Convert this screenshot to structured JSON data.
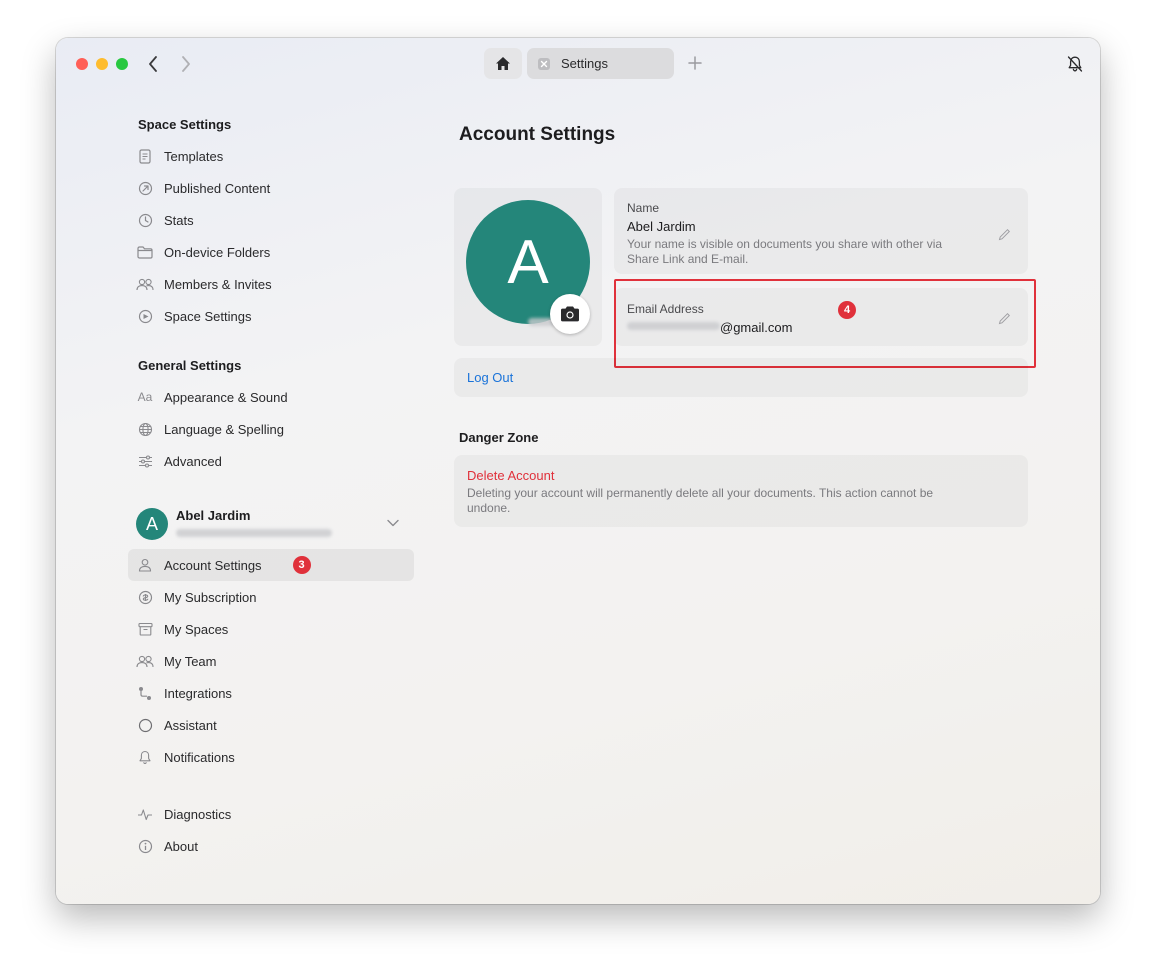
{
  "tabs": {
    "home_label": "",
    "settings_label": "Settings"
  },
  "sidebar": {
    "space_settings": {
      "title": "Space Settings",
      "items": [
        {
          "label": "Templates",
          "icon": "templates-icon"
        },
        {
          "label": "Published Content",
          "icon": "published-icon"
        },
        {
          "label": "Stats",
          "icon": "stats-icon"
        },
        {
          "label": "On-device Folders",
          "icon": "folder-icon"
        },
        {
          "label": "Members & Invites",
          "icon": "members-icon"
        },
        {
          "label": "Space Settings",
          "icon": "space-settings-icon"
        }
      ]
    },
    "general_settings": {
      "title": "General Settings",
      "items": [
        {
          "label": "Appearance & Sound",
          "icon": "appearance-icon"
        },
        {
          "label": "Language & Spelling",
          "icon": "globe-icon"
        },
        {
          "label": "Advanced",
          "icon": "sliders-icon"
        }
      ]
    },
    "user": {
      "avatar_letter": "A",
      "name": "Abel Jardim"
    },
    "account_items": [
      {
        "label": "Account Settings",
        "icon": "person-icon",
        "active": true,
        "badge": "3"
      },
      {
        "label": "My Subscription",
        "icon": "subscription-icon"
      },
      {
        "label": "My Spaces",
        "icon": "archive-icon"
      },
      {
        "label": "My Team",
        "icon": "team-icon"
      },
      {
        "label": "Integrations",
        "icon": "integrations-icon"
      },
      {
        "label": "Assistant",
        "icon": "assistant-icon"
      },
      {
        "label": "Notifications",
        "icon": "bell-icon"
      }
    ],
    "footer_items": [
      {
        "label": "Diagnostics",
        "icon": "pulse-icon"
      },
      {
        "label": "About",
        "icon": "info-icon"
      }
    ]
  },
  "main": {
    "title": "Account Settings",
    "avatar_letter": "A",
    "name_field": {
      "label": "Name",
      "value": "Abel Jardim",
      "description": "Your name is visible on documents you share with other via Share Link and E-mail."
    },
    "email_field": {
      "label": "Email Address",
      "value": "@gmail.com",
      "badge": "4"
    },
    "logout_label": "Log Out",
    "danger_zone": {
      "title": "Danger Zone",
      "delete_label": "Delete Account",
      "delete_description": "Deleting your account will permanently delete all your documents. This action cannot be undone."
    }
  },
  "colors": {
    "accent_blue": "#1a73d9",
    "danger_red": "#e0313b",
    "avatar_teal": "#24867a",
    "highlight_red": "#e0313b"
  }
}
